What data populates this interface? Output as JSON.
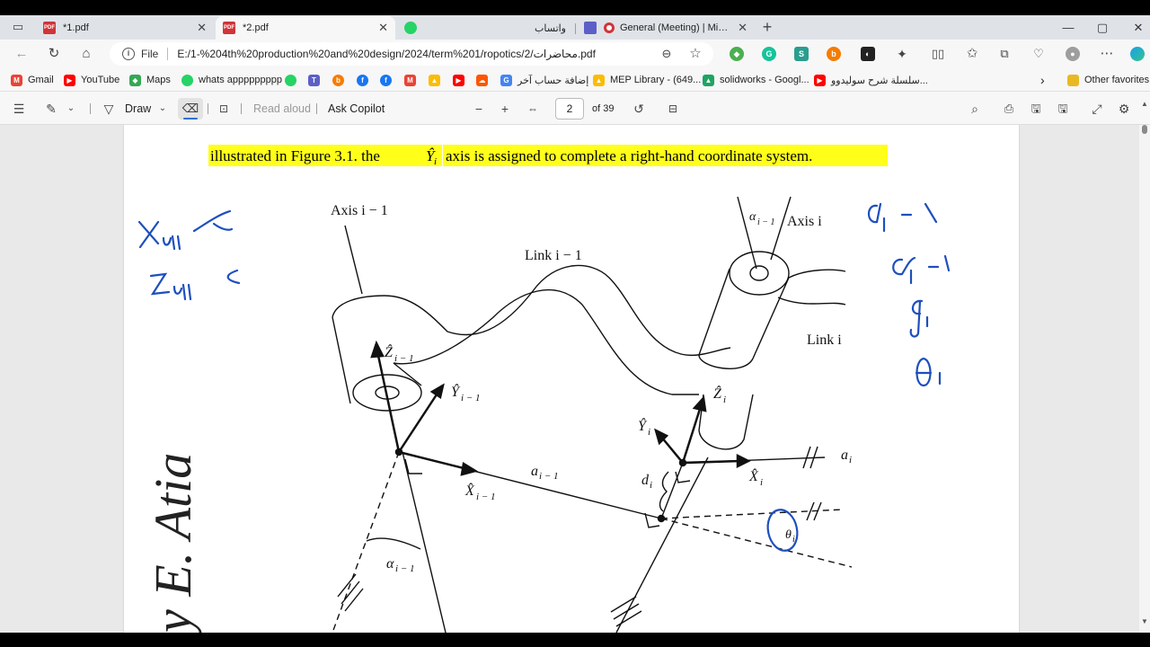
{
  "tabs": [
    {
      "title": "*1.pdf"
    },
    {
      "title": "*2.pdf"
    },
    {
      "title": "واتساب"
    },
    {
      "title": "General (Meeting) | Microsoft Teams"
    }
  ],
  "window": {
    "minimize": "—",
    "maximize": "▢",
    "close": "✕",
    "new_tab": "+"
  },
  "address": {
    "info_label": "File",
    "url": "E:/1-%204th%20production%20and%20design/2024/term%201/ropotics/2/محاضرات.pdf"
  },
  "bookmarks": [
    {
      "label": "Gmail",
      "color": "#ea4335",
      "icon": "gmail-icon"
    },
    {
      "label": "YouTube",
      "color": "#ff0000",
      "icon": "youtube-icon"
    },
    {
      "label": "Maps",
      "color": "#34a853",
      "icon": "maps-icon"
    },
    {
      "label": "whats appppppppp",
      "color": "#25d366",
      "icon": "whatsapp-icon"
    },
    {
      "label": "إضافة حساب آخر",
      "color": "#4285f4",
      "icon": "google-icon"
    },
    {
      "label": "MEP Library - (649...",
      "color": "#fbbc04",
      "icon": "drive-icon"
    },
    {
      "label": "solidworks - Googl...",
      "color": "#1fa463",
      "icon": "drive-icon"
    },
    {
      "label": "سلسلة شرح سوليدوو...",
      "color": "#ff0000",
      "icon": "youtube-icon"
    },
    {
      "label": "Other favorites",
      "color": "#e8b923",
      "icon": "folder-icon"
    }
  ],
  "pdf_toolbar": {
    "draw_label": "Draw",
    "read_aloud_label": "Read aloud",
    "ask_copilot_label": "Ask Copilot",
    "page_current": "2",
    "page_total": "of 39"
  },
  "document": {
    "caption_parts": [
      "illustrated in Figure 3.1. the",
      "axis is assigned to complete a right-hand coordinate system."
    ],
    "caption_symbol": "Ŷ",
    "caption_symbol_sub": "i",
    "figure_labels": {
      "axis_prev": "Axis i − 1",
      "axis_curr": "Axis i",
      "link_prev": "Link i − 1",
      "link_curr": "Link i",
      "alpha_top": "α",
      "alpha_top_sub": "i − 1",
      "z_prev": "Ẑ",
      "z_prev_sub": "i − 1",
      "y_prev": "Ŷ",
      "y_prev_sub": "i − 1",
      "x_prev": "X̂",
      "x_prev_sub": "i − 1",
      "a_prev": "a",
      "a_prev_sub": "i − 1",
      "alpha_bottom": "α",
      "alpha_bottom_sub": "i − 1",
      "z_curr": "Ẑ",
      "z_curr_sub": "i",
      "y_curr": "Ŷ",
      "y_curr_sub": "i",
      "x_curr": "X̂",
      "x_curr_sub": "i",
      "d_curr": "d",
      "d_curr_sub": "i",
      "a_curr": "a",
      "a_curr_sub": "i",
      "theta": "θ",
      "theta_sub": "i"
    },
    "watermark": "y E. Atia"
  },
  "colors": {
    "ink": "#1d4fbf",
    "highlight": "#ffff1a"
  }
}
